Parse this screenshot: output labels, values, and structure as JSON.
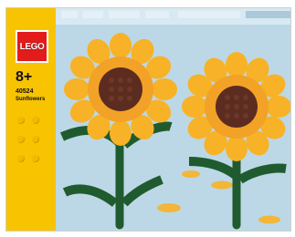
{
  "brand": {
    "logo_text": "LEGO"
  },
  "product": {
    "age": "8+",
    "set_number": "40524",
    "name": "Sunflowers"
  },
  "icons": {
    "logo": "lego-logo-icon",
    "flower_left": "sunflower-icon",
    "flower_right": "sunflower-icon"
  },
  "colors": {
    "sky": "#bcd8e6",
    "yellow_strip": "#f8c300",
    "logo_red": "#e21b1b",
    "petal": "#f7b227",
    "center": "#5b2c1f",
    "stem": "#1f5b2f"
  }
}
